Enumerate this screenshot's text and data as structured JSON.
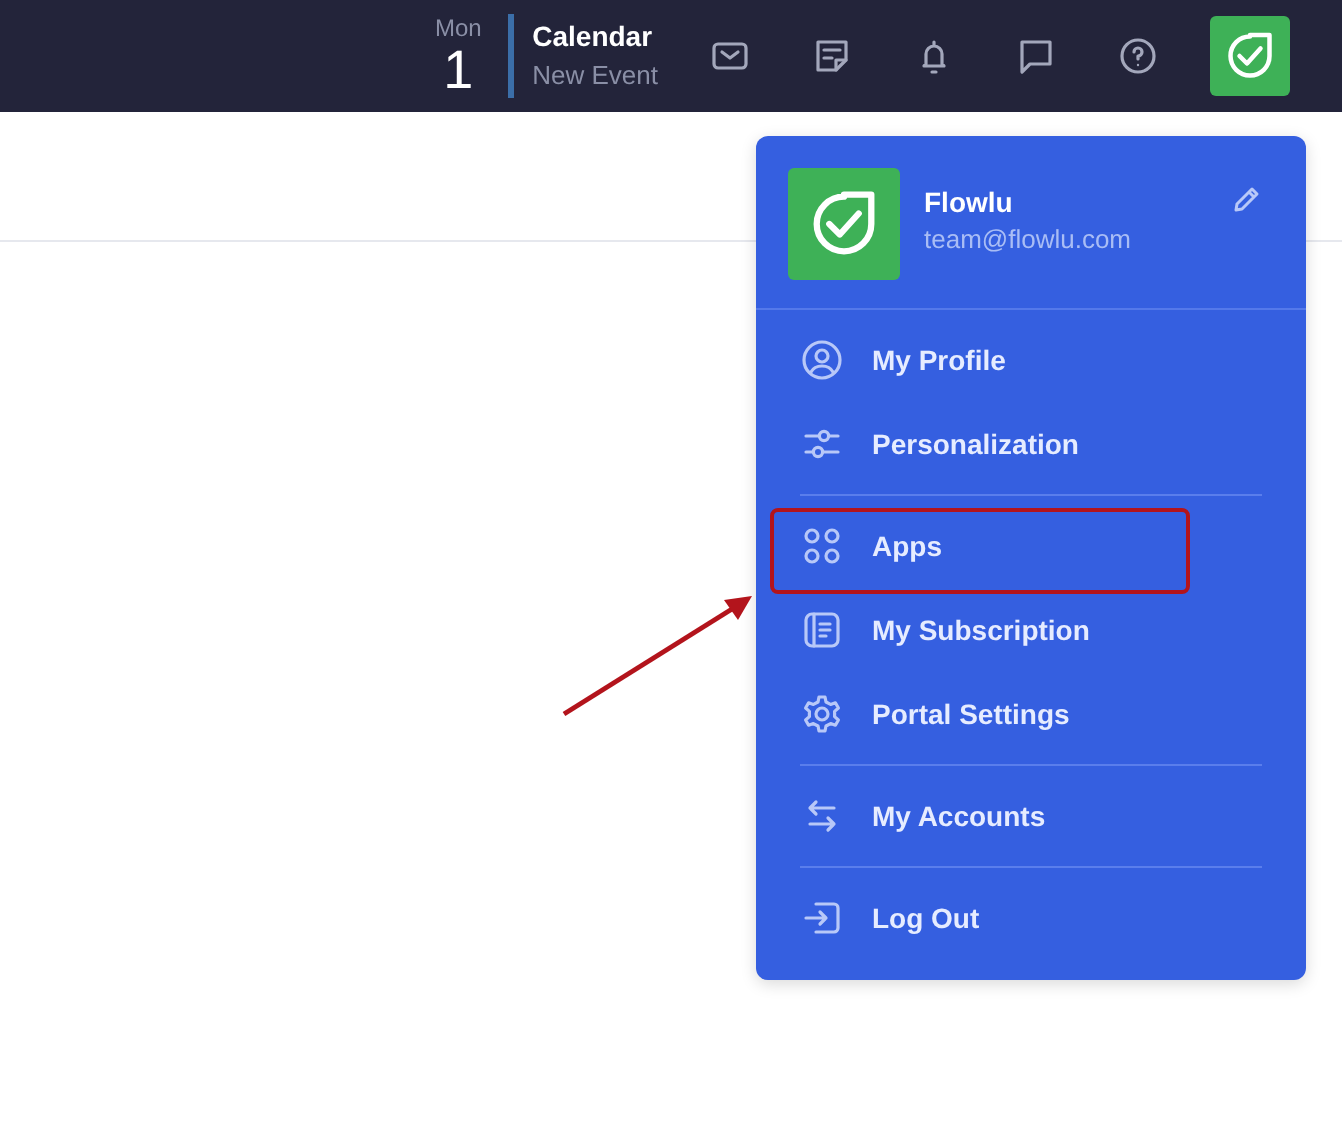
{
  "top_bar": {
    "date": {
      "weekday": "Mon",
      "day": "1"
    },
    "event": {
      "title": "Calendar",
      "subtitle": "New Event"
    }
  },
  "user_menu": {
    "name": "Flowlu",
    "email": "team@flowlu.com",
    "groups": [
      [
        {
          "label": "My Profile",
          "highlighted": false
        },
        {
          "label": "Personalization",
          "highlighted": false
        }
      ],
      [
        {
          "label": "Apps",
          "highlighted": true
        },
        {
          "label": "My Subscription",
          "highlighted": false
        },
        {
          "label": "Portal Settings",
          "highlighted": false
        }
      ],
      [
        {
          "label": "My Accounts",
          "highlighted": false
        }
      ],
      [
        {
          "label": "Log Out",
          "highlighted": false
        }
      ]
    ]
  }
}
